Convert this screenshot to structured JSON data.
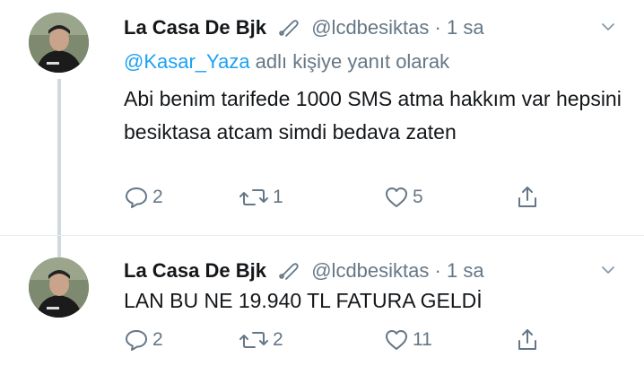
{
  "tweets": [
    {
      "author_name": "La Casa De Bjk",
      "handle": "@lcdbesiktas",
      "separator": "·",
      "time": "1 sa",
      "replying_mention": "@Kasar_Yaza",
      "replying_suffix": " adlı kişiye yanıt olarak",
      "text": "Abi benim tarifede 1000 SMS atma hakkım var hepsini besiktasa atcam simdi bedava zaten",
      "reply_count": "2",
      "retweet_count": "1",
      "like_count": "5"
    },
    {
      "author_name": "La Casa De Bjk",
      "handle": "@lcdbesiktas",
      "separator": "·",
      "time": "1 sa",
      "text": "LAN BU NE 19.940 TL FATURA GELDİ",
      "reply_count": "2",
      "retweet_count": "2",
      "like_count": "11"
    }
  ],
  "icons": {
    "reply": "speech-bubble-icon",
    "retweet": "retweet-arrows-icon",
    "like": "heart-icon",
    "share": "share-upload-icon",
    "badge": "safety-pin-icon",
    "more": "chevron-down-icon"
  },
  "colors": {
    "text": "#14171a",
    "muted": "#657786",
    "link": "#1da1f2",
    "thread_line": "#cfd9de"
  }
}
